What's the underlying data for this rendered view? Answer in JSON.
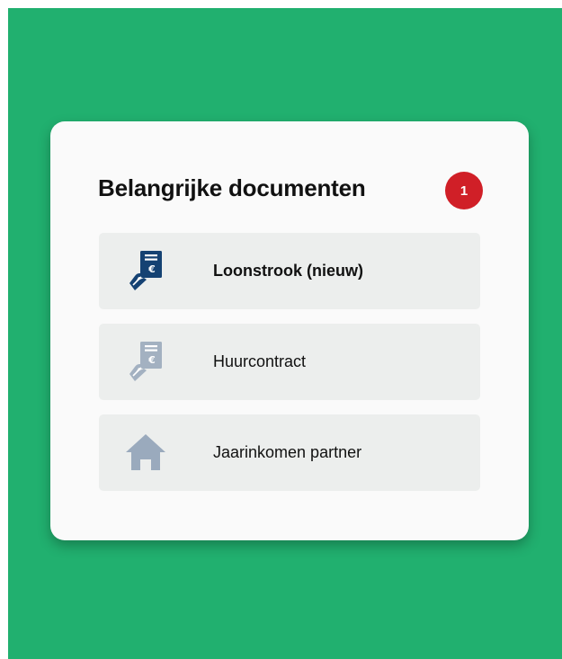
{
  "panel": {
    "title": "Belangrijke documenten",
    "badge_count": "1"
  },
  "documents": [
    {
      "label": "Loonstrook (nieuw)",
      "icon": "payslip-hand-euro-icon",
      "is_new": true,
      "icon_color": "#154273"
    },
    {
      "label": "Huurcontract",
      "icon": "payslip-hand-euro-icon",
      "is_new": false,
      "icon_color": "#a3b1c1"
    },
    {
      "label": "Jaarinkomen partner",
      "icon": "house-icon",
      "is_new": false,
      "icon_color": "#9aaabd"
    }
  ],
  "colors": {
    "background": "#21b06f",
    "card": "#fafafa",
    "item": "#eceeed",
    "badge": "#d01f27"
  }
}
